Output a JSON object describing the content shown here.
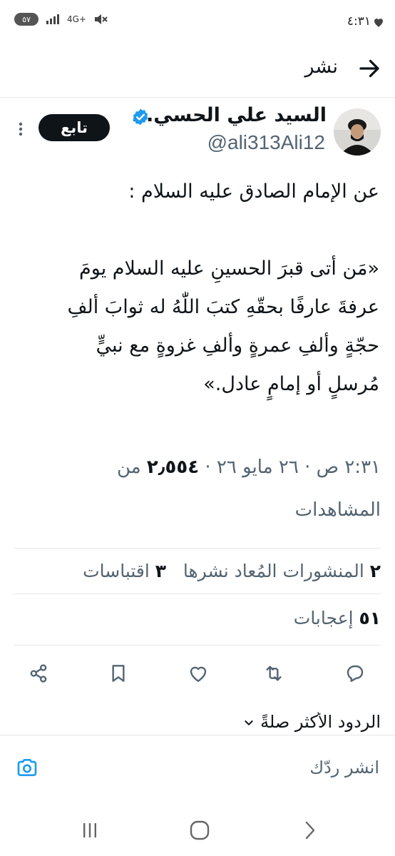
{
  "status_bar": {
    "time": "٤:٣١",
    "battery": "٥٧",
    "network": "4G+"
  },
  "header": {
    "title": "نشر"
  },
  "tweet": {
    "author_name": "السيد علي الحسي...",
    "handle": "@ali313Ali12",
    "follow_label": "تابع",
    "text": "عن الإمام الصادق عليه السلام :\n\n«مَن أتى قبرَ الحسينِ عليه السلام يومَ\nعرفةَ عارفًا بحقّهِ كتبَ اللّٰهُ له ثوابَ ألفِ\nحجّةٍ وألفِ عمرةٍ وألفِ غزوةٍ مع نبيٍّ\nمُرسلٍ أو إمامٍ عادل.»",
    "timestamp": "٢:٣١ ص · ٢٦ مايو ٢٦",
    "views_count": "٢٫٥٥٤",
    "views_label_part1": "من",
    "views_label_part2": "المشاهدات"
  },
  "stats": {
    "reposts_count": "٢",
    "reposts_label": "المنشورات المُعاد نشرها",
    "quotes_count": "٣",
    "quotes_label": "اقتباسات",
    "likes_count": "٥١",
    "likes_label": "إعجابات"
  },
  "actions": [
    "reply-icon",
    "retweet-icon",
    "like-icon",
    "bookmark-icon",
    "share-icon"
  ],
  "replies": {
    "sort_label": "الردود الأكثر صلةً"
  },
  "reply_box": {
    "placeholder": "انشر ردّك"
  },
  "colors": {
    "accent": "#1d9bf0",
    "text": "#0f1419",
    "secondary": "#536471"
  }
}
